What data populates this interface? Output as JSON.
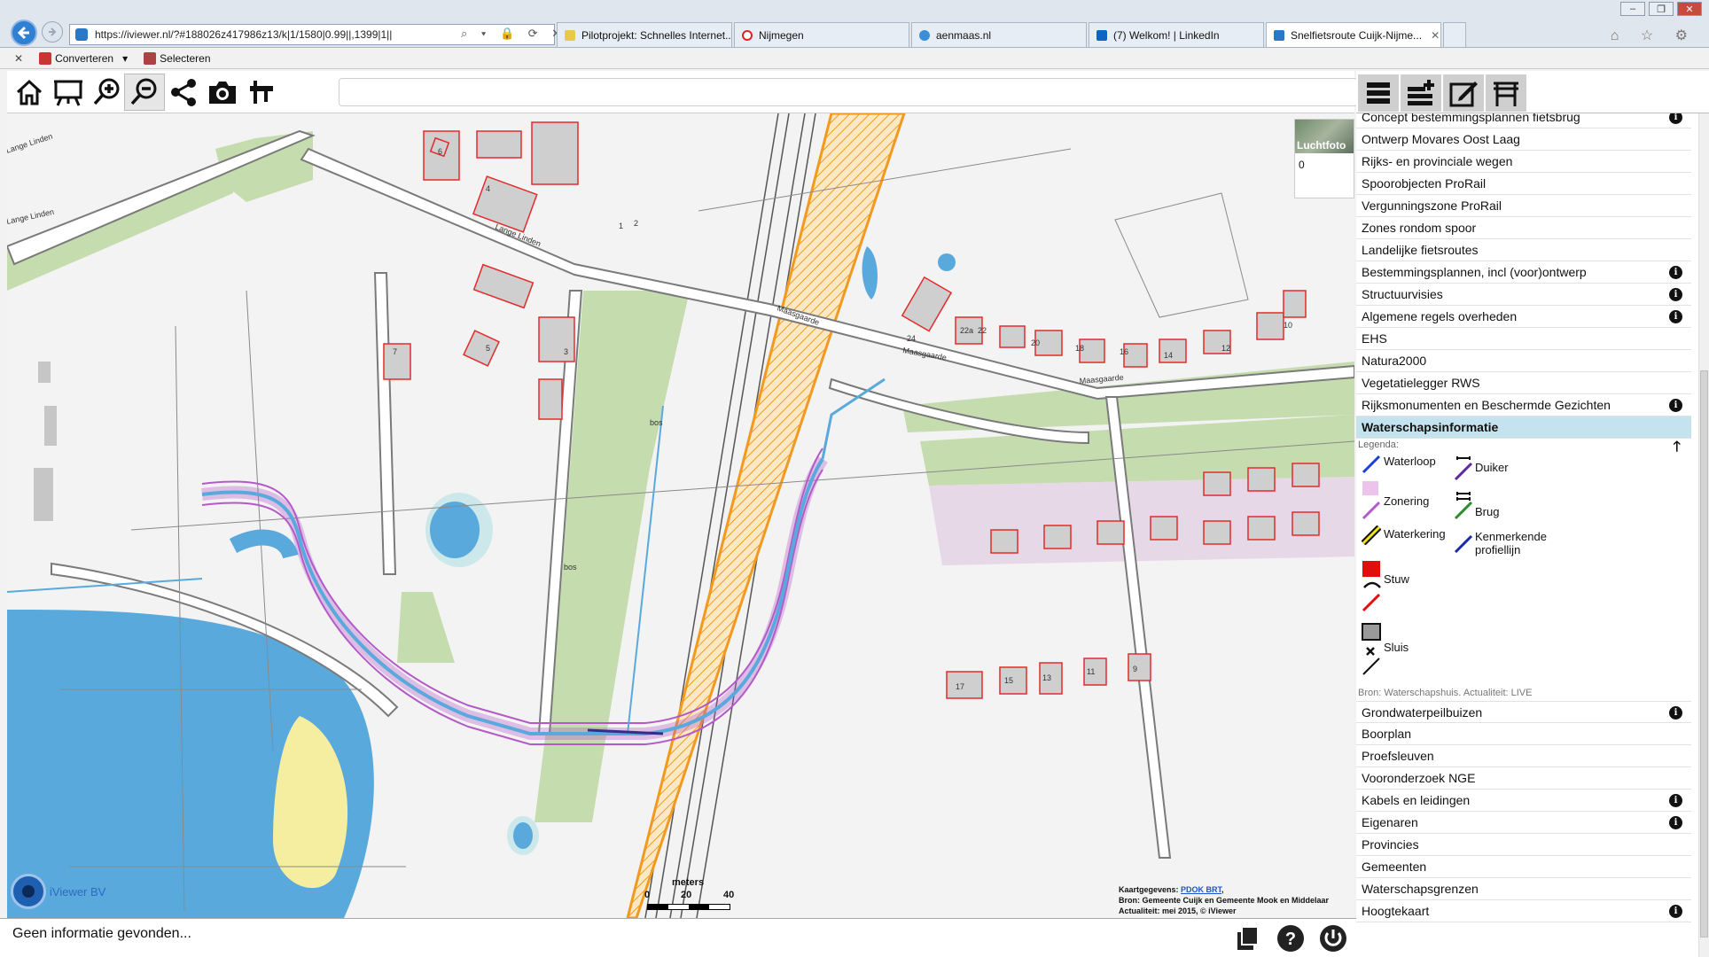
{
  "browser": {
    "url": "https://iviewer.nl/?#188026z417986z13/k|1/1580|0.99||,1399|1||",
    "tabs": [
      {
        "label": "Pilotprojekt: Schnelles Internet...",
        "color": "#e8c94a"
      },
      {
        "label": "Nijmegen",
        "color": "#d22"
      },
      {
        "label": "aenmaas.nl",
        "color": "#3b8ed8"
      },
      {
        "label": "(7) Welkom! | LinkedIn",
        "color": "#0a66c2"
      },
      {
        "label": "Snelfietsroute Cuijk-Nijme...",
        "color": "#2a78c8",
        "close": "✕"
      }
    ],
    "commands": {
      "close": "✕",
      "convert": "Converteren",
      "select": "Selecteren"
    },
    "window_buttons": [
      "–",
      "❐",
      "✕"
    ],
    "ie_icons": "⌂ ☆ ⚙"
  },
  "toolbar": {
    "tools": [
      "home-icon",
      "presentation-icon",
      "zoom-in-icon",
      "zoom-out-icon",
      "share-icon",
      "camera-icon",
      "measure-icon"
    ],
    "selected_tool": "zoom-out-icon",
    "search_value": ""
  },
  "panel_tabs": [
    "layers-icon",
    "add-layer-icon",
    "edit-icon",
    "tools-icon"
  ],
  "map": {
    "luchtfoto": {
      "label": "Luchtfoto",
      "value": "0"
    },
    "scale": {
      "unit": "meters",
      "ticks": [
        "0",
        "20",
        "40"
      ]
    },
    "credits": {
      "line1_prefix": "Kaartgegevens: ",
      "line1_link": "PDOK BRT",
      "line1_suffix": ",",
      "line2": "Bron: Gemeente Cuijk en Gemeente Mook en Middelaar",
      "line3": "Actualiteit: mei 2015, © iViewer"
    },
    "logo_text": "iViewer BV",
    "labels": {
      "lange_linden_1": "Lange Linden",
      "lange_linden_2": "Lange Linden",
      "lange_linden_3": "Lange Linden",
      "maasgaarde_1": "Maasgaarde",
      "maasgaarde_2": "Maasgaarde",
      "maasgaarde_3": "Maasgaarde",
      "bos1": "bos",
      "bos2": "bos",
      "n1": "6",
      "n2": "4",
      "n3": "2",
      "n4": "1",
      "n5": "3",
      "n6": "5",
      "n7": "7",
      "n8": "24",
      "n9": "22a",
      "n10": "22",
      "n11": "20",
      "n12": "18",
      "n13": "16",
      "n14": "14",
      "n15": "12",
      "n16": "10",
      "n17": "17",
      "n18": "15",
      "n19": "13",
      "n20": "11",
      "n21": "9"
    }
  },
  "status": {
    "text": "Geen informatie gevonden..."
  },
  "layers": [
    {
      "label": "Concept bestemmingsplannen fietsbrug",
      "info": true
    },
    {
      "label": "Ontwerp Movares Oost Laag",
      "info": false
    },
    {
      "label": "Rijks- en provinciale wegen",
      "info": false
    },
    {
      "label": "Spoorobjecten ProRail",
      "info": false
    },
    {
      "label": "Vergunningszone ProRail",
      "info": false
    },
    {
      "label": "Zones rondom spoor",
      "info": false
    },
    {
      "label": "Landelijke fietsroutes",
      "info": false
    },
    {
      "label": "Bestemmingsplannen, incl (voor)ontwerp",
      "info": true
    },
    {
      "label": "Structuurvisies",
      "info": true
    },
    {
      "label": "Algemene regels overheden",
      "info": true
    },
    {
      "label": "EHS",
      "info": false
    },
    {
      "label": "Natura2000",
      "info": false
    },
    {
      "label": "Vegetatielegger RWS",
      "info": false
    },
    {
      "label": "Rijksmonumenten en Beschermde Gezichten",
      "info": true
    },
    {
      "label": "Waterschapsinformatie",
      "info": false,
      "active": true
    }
  ],
  "layers_after": [
    {
      "label": "Grondwaterpeilbuizen",
      "info": true
    },
    {
      "label": "Boorplan",
      "info": false
    },
    {
      "label": "Proefsleuven",
      "info": false
    },
    {
      "label": "Vooronderzoek NGE",
      "info": false
    },
    {
      "label": "Kabels en leidingen",
      "info": true
    },
    {
      "label": "Eigenaren",
      "info": true
    },
    {
      "label": "Provincies",
      "info": false
    },
    {
      "label": "Gemeenten",
      "info": false
    },
    {
      "label": "Waterschapsgrenzen",
      "info": false
    },
    {
      "label": "Hoogtekaart",
      "info": true
    }
  ],
  "info_glyph": "i",
  "legend": {
    "title": "Legenda:",
    "collapse_glyph": "🡑",
    "items": {
      "waterloop": "Waterloop",
      "duiker": "Duiker",
      "zonering": "Zonering",
      "brug": "Brug",
      "waterkering": "Waterkering",
      "kenmerkende": "Kenmerkende profiellijn",
      "stuw": "Stuw",
      "sluis": "Sluis"
    },
    "source": "Bron: Waterschapshuis. Actualiteit: LIVE"
  },
  "colors": {
    "water": "#5aa9dd",
    "green": "#c5dcae",
    "building_fill": "#cfcfcf",
    "building_outline": "#e32b2b",
    "zone_orange": "#f29a1f",
    "waterloop_blue": "#1c6fd8",
    "zonering_purple": "#b45ac8",
    "active_row": "#c4e3ef"
  }
}
